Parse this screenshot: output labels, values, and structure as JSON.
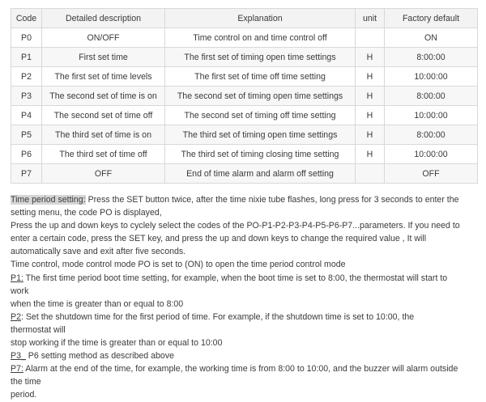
{
  "table": {
    "headers": [
      "Code",
      "Detailed description",
      "Explanation",
      "unit",
      "Factory default"
    ],
    "rows": [
      [
        "P0",
        "ON/OFF",
        "Time control on and time control off",
        "",
        "ON"
      ],
      [
        "P1",
        "First set time",
        "The first set of timing open time settings",
        "H",
        "8:00:00"
      ],
      [
        "P2",
        "The first set of time levels",
        "The first set of time off time setting",
        "H",
        "10:00:00"
      ],
      [
        "P3",
        "The second set of time is on",
        "The second set of timing open time settings",
        "H",
        "8:00:00"
      ],
      [
        "P4",
        "The second set of time off",
        "The second set of timing off time setting",
        "H",
        "10:00:00"
      ],
      [
        "P5",
        "The third set of time is on",
        "The third set of timing open time settings",
        "H",
        "8:00:00"
      ],
      [
        "P6",
        "The third set of time off",
        "The third set of timing closing time setting",
        "H",
        "10:00:00"
      ],
      [
        "P7",
        "OFF",
        "End of time alarm and alarm off setting",
        "",
        "OFF"
      ]
    ]
  },
  "notes": {
    "lines": [
      {
        "lead": "Time period setting:",
        "lead_style": "hl",
        "text": " Press the SET button twice, after the time nixie tube flashes, long press for 3 seconds to enter the"
      },
      {
        "lead": "",
        "lead_style": "",
        "text": "setting menu, the code PO is displayed,"
      },
      {
        "lead": "",
        "lead_style": "",
        "text": "Press the up and down keys to cyclely select the codes of the PO-P1-P2-P3-P4-P5-P6-P7...parameters. If you need to"
      },
      {
        "lead": "",
        "lead_style": "",
        "text": "enter a certain code, press the SET key, and press the up and down keys to change the required value , It will"
      },
      {
        "lead": "",
        "lead_style": "",
        "text": "automatically save and exit after five seconds."
      },
      {
        "lead": "",
        "lead_style": "",
        "text": "Time control, mode control mode PO is set to (ON) to open the time period control mode"
      },
      {
        "lead": "P1:",
        "lead_style": "u",
        "text": " The first time period boot time setting, for example, when the boot time is set to 8:00, the thermostat will start to"
      },
      {
        "lead": "",
        "lead_style": "",
        "text": "work"
      },
      {
        "lead": "",
        "lead_style": "",
        "text": "when the time is greater than or equal to 8:00"
      },
      {
        "lead": "P2",
        "lead_style": "u",
        "text": ": Set the shutdown time for the first period of time. For example, if the shutdown time is set to 10:00, the"
      },
      {
        "lead": "",
        "lead_style": "",
        "text": "thermostat will"
      },
      {
        "lead": "",
        "lead_style": "",
        "text": "stop working if the time is greater than or equal to 10:00"
      },
      {
        "lead": "P3_",
        "lead_style": "u",
        "text": " P6 setting method as described above"
      },
      {
        "lead": "P7:",
        "lead_style": "u",
        "text": " Alarm at the end of the time, for example, the working time is from 8:00 to 10:00, and the buzzer will alarm outside"
      },
      {
        "lead": "",
        "lead_style": "",
        "text": "the time"
      },
      {
        "lead": "",
        "lead_style": "",
        "text": "period."
      }
    ]
  }
}
